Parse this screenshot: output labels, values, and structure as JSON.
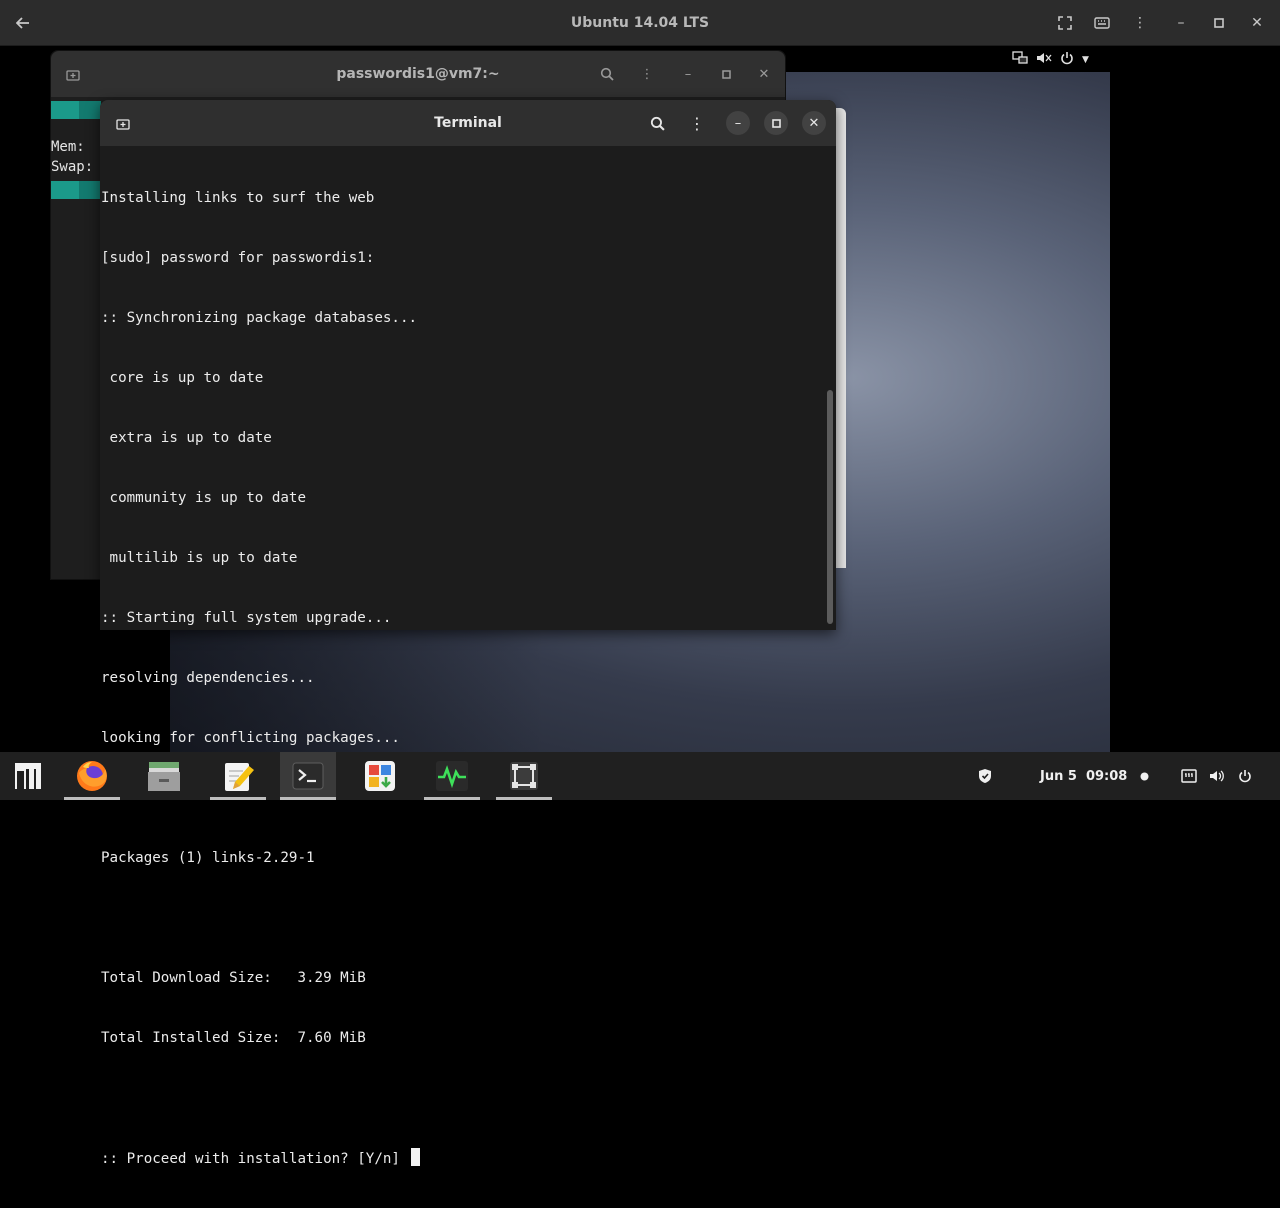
{
  "viewer": {
    "title": "Ubuntu 14.04 LTS"
  },
  "back_window": {
    "title": "passwordis1@vm7:~",
    "lines": [
      "Mem:",
      "Swap:"
    ]
  },
  "terminal": {
    "title": "Terminal",
    "lines": [
      "Installing links to surf the web",
      "[sudo] password for passwordis1:",
      ":: Synchronizing package databases...",
      " core is up to date",
      " extra is up to date",
      " community is up to date",
      " multilib is up to date",
      ":: Starting full system upgrade...",
      "resolving dependencies...",
      "looking for conflicting packages...",
      "",
      "Packages (1) links-2.29-1",
      "",
      "Total Download Size:   3.29 MiB",
      "Total Installed Size:  7.60 MiB",
      ""
    ],
    "prompt": ":: Proceed with installation? [Y/n] "
  },
  "taskbar": {
    "apps": [
      {
        "name": "menu-icon"
      },
      {
        "name": "firefox-icon"
      },
      {
        "name": "files-icon"
      },
      {
        "name": "text-editor-icon"
      },
      {
        "name": "terminal-icon"
      },
      {
        "name": "software-icon"
      },
      {
        "name": "system-monitor-icon"
      },
      {
        "name": "screenshot-icon"
      }
    ],
    "clock": "Jun 5  09:08"
  },
  "colors": {
    "accent_teal": "#1b9a8a",
    "terminal_bg": "#1c1c1c",
    "header_bg": "#2f2f2f"
  }
}
